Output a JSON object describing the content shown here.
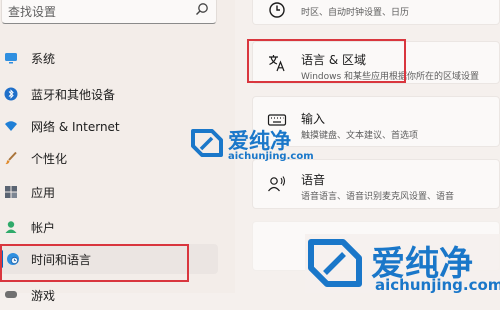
{
  "search": {
    "placeholder": "查找设置"
  },
  "sidebar": {
    "items": [
      {
        "label": "系统",
        "icon": "monitor-icon"
      },
      {
        "label": "蓝牙和其他设备",
        "icon": "bluetooth-icon"
      },
      {
        "label": "网络 & Internet",
        "icon": "wifi-icon"
      },
      {
        "label": "个性化",
        "icon": "brush-icon"
      },
      {
        "label": "应用",
        "icon": "apps-icon"
      },
      {
        "label": "帐户",
        "icon": "person-icon"
      },
      {
        "label": "时间和语言",
        "icon": "globe-clock-icon",
        "selected": true
      },
      {
        "label": "游戏",
        "icon": "game-icon"
      }
    ]
  },
  "cards": [
    {
      "title": "",
      "desc": "时区、自动时钟设置、日历",
      "icon": "clock-icon"
    },
    {
      "title": "语言 & 区域",
      "desc": "Windows 和某些应用根据你所在的区域设置",
      "icon": "language-icon"
    },
    {
      "title": "输入",
      "desc": "触摸键盘、文本建议、首选项",
      "icon": "keyboard-icon"
    },
    {
      "title": "语音",
      "desc": "语音语言、语音识别麦克风设置、语音",
      "icon": "speech-icon"
    }
  ],
  "watermark": {
    "brand": "爱纯净",
    "url": "aichunjing.com"
  },
  "colors": {
    "accent": "#0067c0",
    "highlight": "#d9363e",
    "watermark": "#1a77c9"
  }
}
